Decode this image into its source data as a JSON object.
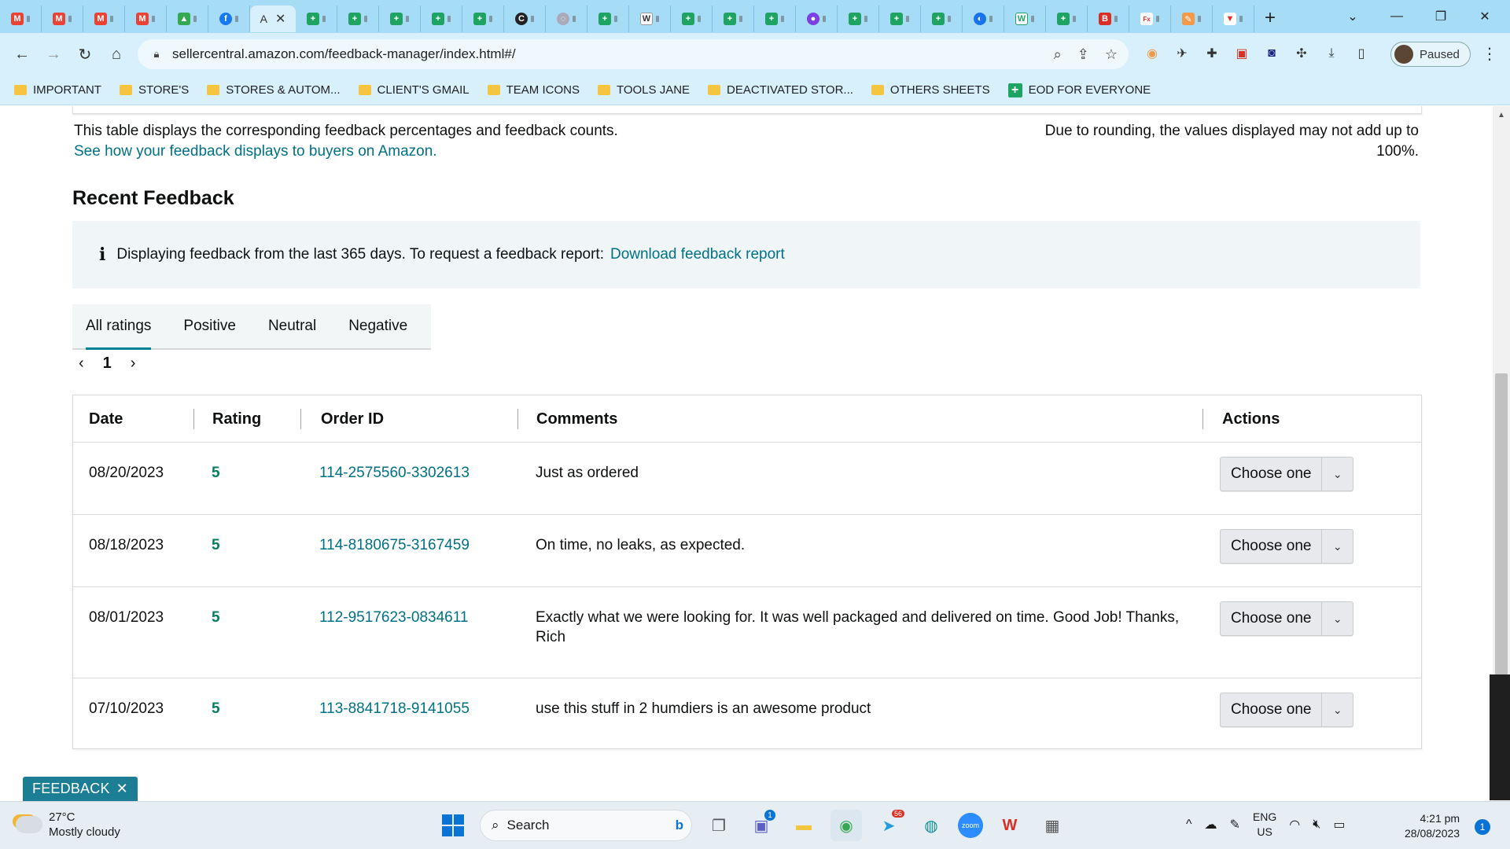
{
  "browser": {
    "active_tab_label": "A",
    "url": "sellercentral.amazon.com/feedback-manager/index.html#/",
    "profile_label": "Paused",
    "bookmarks": [
      {
        "label": "IMPORTANT",
        "icon": "folder-icon"
      },
      {
        "label": "STORE'S",
        "icon": "folder-icon"
      },
      {
        "label": "STORES & AUTOM...",
        "icon": "folder-icon"
      },
      {
        "label": "CLIENT'S GMAIL",
        "icon": "folder-icon"
      },
      {
        "label": "TEAM ICONS",
        "icon": "folder-icon"
      },
      {
        "label": "TOOLS JANE",
        "icon": "folder-icon"
      },
      {
        "label": "DEACTIVATED STOR...",
        "icon": "folder-icon"
      },
      {
        "label": "OTHERS SHEETS",
        "icon": "folder-icon"
      },
      {
        "label": "EOD FOR EVERYONE",
        "icon": "sheets-icon"
      }
    ]
  },
  "page": {
    "disclaimer_left": "This table displays the corresponding feedback percentages and feedback counts.",
    "disclaimer_link": "See how your feedback displays to buyers on Amazon.",
    "disclaimer_right": "Due to rounding, the values displayed may not add up to 100%.",
    "section_title": "Recent Feedback",
    "alert_text": "Displaying feedback from the last 365 days. To request a feedback report:",
    "alert_link": "Download feedback report",
    "filter_tabs": [
      "All ratings",
      "Positive",
      "Neutral",
      "Negative"
    ],
    "pager_page": "1",
    "table": {
      "headers": {
        "date": "Date",
        "rating": "Rating",
        "order_id": "Order ID",
        "comments": "Comments",
        "actions": "Actions"
      },
      "rows": [
        {
          "date": "08/20/2023",
          "rating": "5",
          "order_id": "114-2575560-3302613",
          "comment": "Just as ordered",
          "action": "Choose one"
        },
        {
          "date": "08/18/2023",
          "rating": "5",
          "order_id": "114-8180675-3167459",
          "comment": "On time, no leaks, as expected.",
          "action": "Choose one"
        },
        {
          "date": "08/01/2023",
          "rating": "5",
          "order_id": "112-9517623-0834611",
          "comment": "Exactly what we were looking for. It was well packaged and delivered on time. Good Job! Thanks, Rich",
          "action": "Choose one"
        },
        {
          "date": "07/10/2023",
          "rating": "5",
          "order_id": "113-8841718-9141055",
          "comment": "use this stuff in 2 humdiers is an awesome product",
          "action": "Choose one"
        }
      ]
    },
    "feedback_button": "FEEDBACK"
  },
  "taskbar": {
    "temperature": "27°C",
    "weather": "Mostly cloudy",
    "search_placeholder": "Search",
    "language": "ENG",
    "region": "US",
    "time": "4:21 pm",
    "date": "28/08/2023",
    "notification_count": "1",
    "teams_badge": "1",
    "telegram_badge": "56"
  },
  "colors": {
    "link": "#007185",
    "rating": "#067d62",
    "tab_accent": "#008296",
    "chrome": "#a6dcf5"
  }
}
